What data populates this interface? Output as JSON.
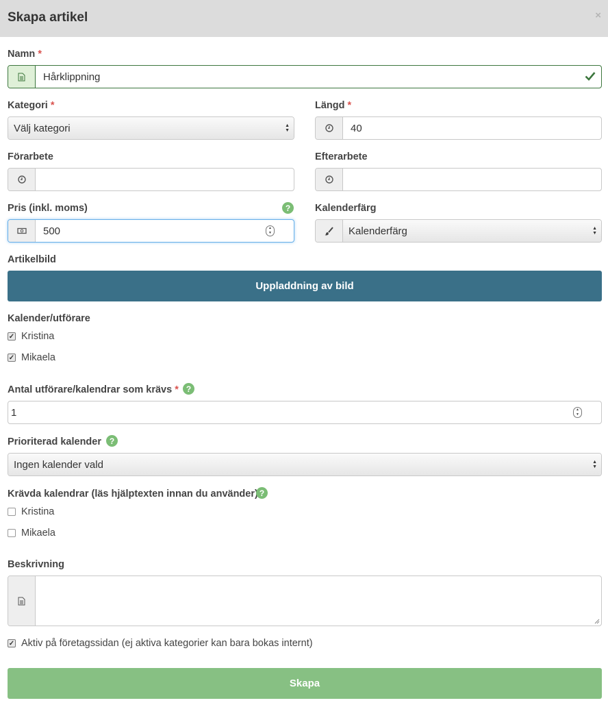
{
  "header": {
    "title": "Skapa artikel",
    "close_glyph": "×"
  },
  "required_mark": "*",
  "name": {
    "label": "Namn",
    "value": "Hårklippning",
    "icon": "document-icon",
    "valid_icon": "check-icon"
  },
  "category": {
    "label": "Kategori",
    "selected": "Välj kategori"
  },
  "length": {
    "label": "Längd",
    "value": "40",
    "icon": "clock-icon"
  },
  "prework": {
    "label": "Förarbete",
    "value": "",
    "icon": "clock-icon"
  },
  "postwork": {
    "label": "Efterarbete",
    "value": "",
    "icon": "clock-icon"
  },
  "price": {
    "label": "Pris (inkl. moms)",
    "value": "500",
    "icon": "money-icon"
  },
  "calendar_color": {
    "label": "Kalenderfärg",
    "selected": "Kalenderfärg",
    "icon": "brush-icon"
  },
  "image": {
    "label": "Artikelbild",
    "button_label": "Uppladdning av bild"
  },
  "performers": {
    "label": "Kalender/utförare",
    "items": [
      {
        "label": "Kristina",
        "checked": true
      },
      {
        "label": "Mikaela",
        "checked": true
      }
    ]
  },
  "required_count": {
    "label": "Antal utförare/kalendrar som krävs",
    "value": "1"
  },
  "prioritized": {
    "label": "Prioriterad kalender",
    "selected": "Ingen kalender vald"
  },
  "required_calendars": {
    "label": "Krävda kalendrar (läs hjälptexten innan du använder)",
    "items": [
      {
        "label": "Kristina",
        "checked": false
      },
      {
        "label": "Mikaela",
        "checked": false
      }
    ]
  },
  "description": {
    "label": "Beskrivning",
    "value": "",
    "icon": "document-icon"
  },
  "active": {
    "label": "Aktiv på företagssidan (ej aktiva kategorier kan bara bokas internt)",
    "checked": true
  },
  "submit": {
    "label": "Skapa"
  },
  "help_glyph": "?",
  "colors": {
    "header_bg": "#dcdcdc",
    "upload_bg": "#3a7088",
    "submit_bg": "#87c083",
    "help": "#7bbd75",
    "required": "#d9534f",
    "valid": "#3c763d"
  }
}
